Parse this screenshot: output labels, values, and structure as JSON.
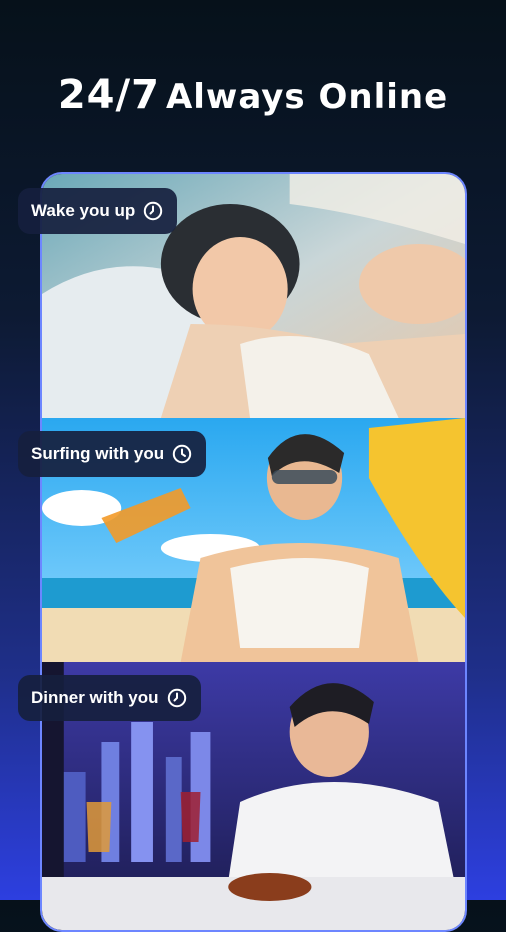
{
  "headline": {
    "number": "24/7",
    "rest": "Always Online"
  },
  "scenes": [
    {
      "label": "Wake you up",
      "icon": "clock-icon"
    },
    {
      "label": "Surfing with you",
      "icon": "clock-icon"
    },
    {
      "label": "Dinner with you",
      "icon": "clock-icon"
    }
  ],
  "colors": {
    "accent_border": "#6d86ff",
    "chip_bg": "#16203e",
    "bottom_gradient": "#2d3fe0"
  }
}
